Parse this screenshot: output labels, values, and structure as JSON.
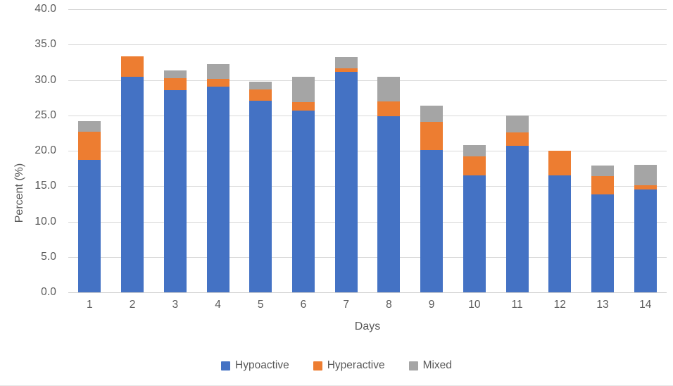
{
  "chart_data": {
    "type": "bar",
    "stacked": true,
    "title": "",
    "xlabel": "Days",
    "ylabel": "Percent (%)",
    "categories": [
      "1",
      "2",
      "3",
      "4",
      "5",
      "6",
      "7",
      "8",
      "9",
      "10",
      "11",
      "12",
      "13",
      "14"
    ],
    "ylim": [
      0,
      40
    ],
    "yticks": [
      0,
      5,
      10,
      15,
      20,
      25,
      30,
      35,
      40
    ],
    "ytick_labels": [
      "0.0",
      "5.0",
      "10.0",
      "15.0",
      "20.0",
      "25.0",
      "30.0",
      "35.0",
      "40.0"
    ],
    "grid": true,
    "legend_position": "bottom",
    "series": [
      {
        "name": "Hypoactive",
        "color": "#4472C4",
        "values": [
          18.7,
          30.4,
          28.6,
          29.1,
          27.1,
          25.7,
          31.1,
          24.9,
          20.1,
          16.5,
          20.7,
          16.5,
          13.8,
          14.5
        ]
      },
      {
        "name": "Hyperactive",
        "color": "#ED7D31",
        "values": [
          4.0,
          2.9,
          1.7,
          1.1,
          1.6,
          1.2,
          0.5,
          2.1,
          4.0,
          2.7,
          1.9,
          3.5,
          2.6,
          0.6
        ]
      },
      {
        "name": "Mixed",
        "color": "#A5A5A5",
        "values": [
          1.5,
          0.0,
          1.0,
          2.0,
          1.1,
          3.6,
          1.6,
          3.5,
          2.3,
          1.6,
          2.4,
          0.0,
          1.5,
          2.9
        ]
      }
    ],
    "totals": [
      24.2,
      33.3,
      31.3,
      32.2,
      29.8,
      30.5,
      33.2,
      30.5,
      26.4,
      20.8,
      25.0,
      20.0,
      17.9,
      18.0
    ]
  },
  "legend": {
    "items": [
      {
        "label": "Hypoactive",
        "color": "#4472C4"
      },
      {
        "label": "Hyperactive",
        "color": "#ED7D31"
      },
      {
        "label": "Mixed",
        "color": "#A5A5A5"
      }
    ]
  }
}
